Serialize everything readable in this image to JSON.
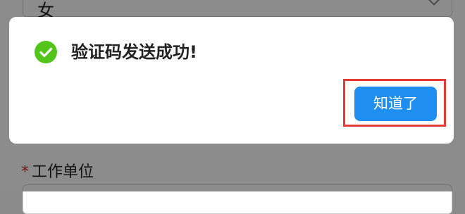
{
  "background_form": {
    "gender_value": "女",
    "work_unit_label": "工作单位",
    "required_mark": "*"
  },
  "dialog": {
    "message": "验证码发送成功!",
    "icon": "check-circle-icon",
    "ok_button_label": "知道了"
  },
  "colors": {
    "success_icon": "#52c41a",
    "primary_button": "#1f8ef1",
    "highlight_border": "#e53935",
    "required_mark": "#e02020"
  }
}
